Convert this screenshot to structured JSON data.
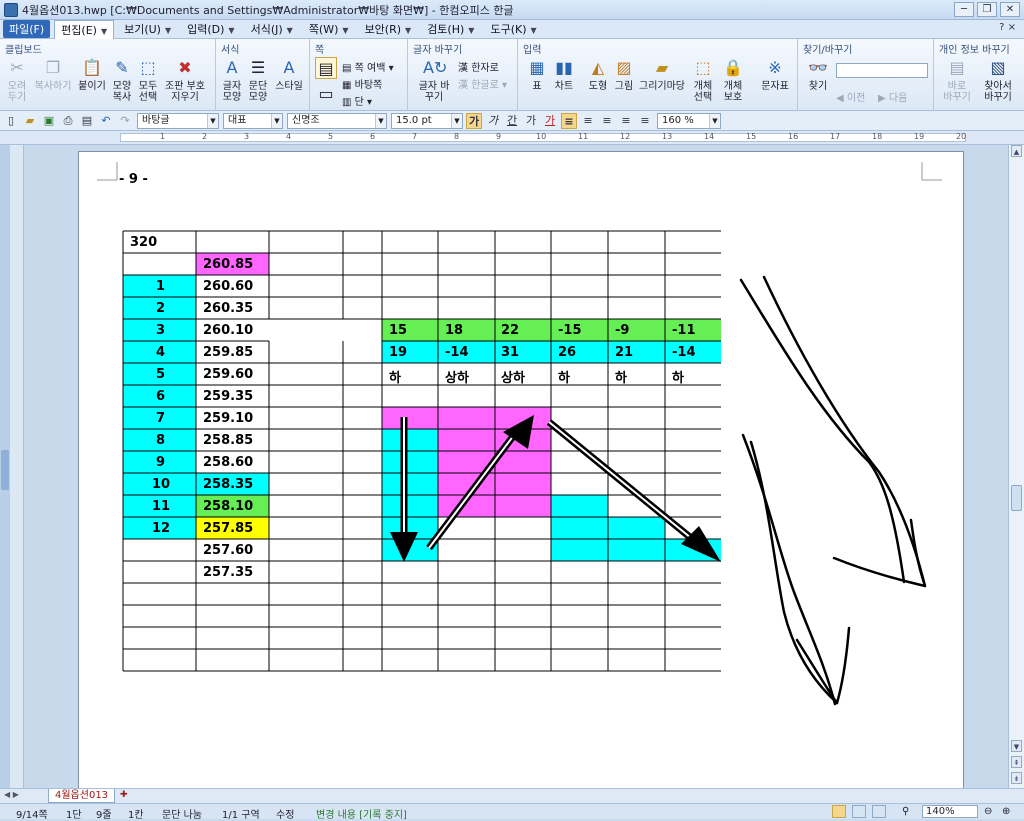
{
  "window": {
    "title": "4월옵션013.hwp [C:₩Documents and Settings₩Administrator₩바탕 화면₩] - 한컴오피스 한글"
  },
  "menu": {
    "file": "파일(F)",
    "items": [
      "편집(E)",
      "보기(U)",
      "입력(D)",
      "서식(J)",
      "쪽(W)",
      "보안(R)",
      "검토(H)",
      "도구(K)"
    ],
    "help": "? ×"
  },
  "ribbon": {
    "groups": {
      "clipboard": "클립보드",
      "format": "서식",
      "page": "쪽",
      "convert": "글자 바꾸기",
      "insert": "입력",
      "find": "찾기/바꾸기",
      "privacy": "개인 정보 바꾸기"
    },
    "buttons": {
      "cut": "오려 두기",
      "copy": "복사하기",
      "paste": "붙이기",
      "format_copy": "모양 복사",
      "select_all": "모두 선택",
      "clear_code": "조판 부호 지우기",
      "char_shape": "글자 모양",
      "para_shape": "문단 모양",
      "style": "스타일",
      "page_margin": "쪽 여백",
      "landscape": "바탕쪽",
      "column": "단",
      "hanja": "한자로",
      "hangul": "한글로",
      "char_convert": "글자 바꾸기",
      "table": "표",
      "chart": "차트",
      "shape": "도형",
      "picture": "그림",
      "gallery": "그리기마당",
      "obj_select": "개체 선택",
      "obj_protect": "개체 보호",
      "symbol": "문자표",
      "find": "찾기",
      "prev": "이전",
      "next": "다음",
      "replace_now": "바로 바꾸기",
      "find_replace": "찾아서 바꾸기"
    }
  },
  "format_bar": {
    "style": "바탕글",
    "lang": "대표",
    "font": "신명조",
    "size": "15.0",
    "size_unit": "pt",
    "bold": "가",
    "italic": "가",
    "underline": "간",
    "strike": "가",
    "color": "가",
    "zoom": "160",
    "zoom_unit": "%"
  },
  "ruler": {
    "marks": [
      "1",
      "2",
      "3",
      "4",
      "5",
      "6",
      "7",
      "8",
      "9",
      "10",
      "11",
      "12",
      "13",
      "14",
      "15",
      "16",
      "17",
      "18",
      "19",
      "20"
    ]
  },
  "page": {
    "header": "- 9 -",
    "table": {
      "first_col": [
        "320",
        "",
        "1",
        "2",
        "3",
        "4",
        "5",
        "6",
        "7",
        "8",
        "9",
        "10",
        "11",
        "12",
        "",
        "",
        "",
        "",
        "",
        ""
      ],
      "second_col": [
        "",
        "260.85",
        "260.60",
        "260.35",
        "260.10",
        "259.85",
        "259.60",
        "259.35",
        "259.10",
        "258.85",
        "258.60",
        "258.35",
        "258.10",
        "257.85",
        "257.60",
        "257.35",
        "",
        "",
        "",
        ""
      ],
      "row_a": [
        "15",
        "18",
        "22",
        "-15",
        "-9",
        "-11"
      ],
      "row_b": [
        "19",
        "-14",
        "31",
        "26",
        "21",
        "-14"
      ],
      "row_c": [
        "하",
        "상하",
        "상하",
        "하",
        "하",
        "하"
      ]
    }
  },
  "tabs": {
    "doc": "4월옵션013"
  },
  "status": {
    "page": "9/14쪽",
    "section": "1단",
    "line": "9줄",
    "col": "1칸",
    "mode": "문단 나눔",
    "zone": "1/1 구역",
    "insert": "수정",
    "track": "변경 내용 [기록 중지]",
    "zoom": "140%"
  },
  "colors": {
    "cyan": "#00ffff",
    "magenta": "#ff66ff",
    "green": "#66ee55",
    "yellow": "#ffff00"
  }
}
